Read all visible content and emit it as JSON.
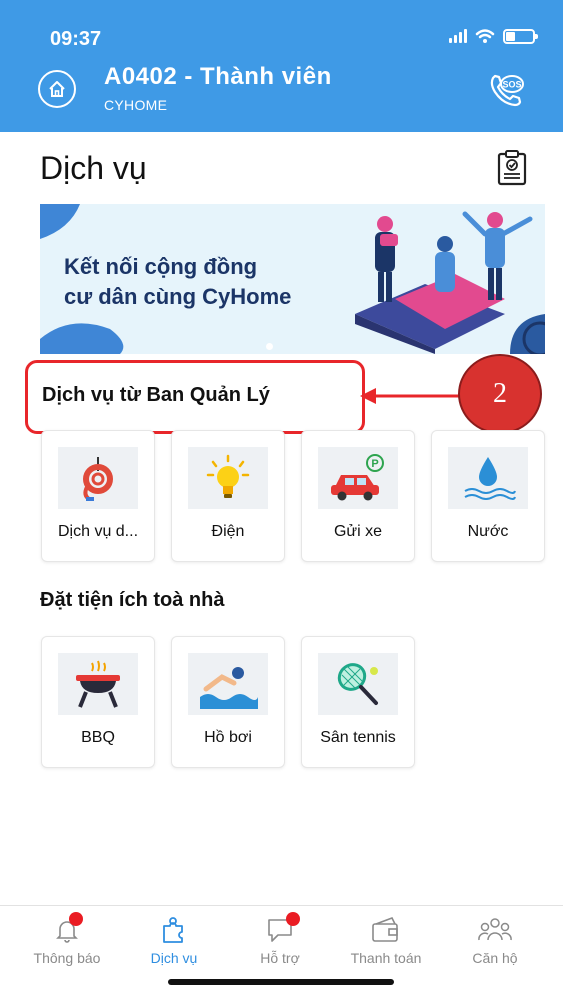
{
  "status_bar": {
    "time": "09:37"
  },
  "header": {
    "title": "A0402 - Thành viên",
    "subtitle": "CYHOME",
    "sos_label": "SOS"
  },
  "page": {
    "title": "Dịch vụ"
  },
  "banner": {
    "line1": "Kết nối cộng đồng",
    "line2": "cư dân cùng CyHome"
  },
  "management_services": {
    "title": "Dịch vụ từ Ban Quản Lý",
    "items": [
      {
        "label": "Dịch vụ d...",
        "icon": "hose-icon"
      },
      {
        "label": "Điện",
        "icon": "lightbulb-icon"
      },
      {
        "label": "Gửi xe",
        "icon": "car-parking-icon"
      },
      {
        "label": "Nước",
        "icon": "water-drop-icon"
      }
    ]
  },
  "annotation": {
    "step": "2",
    "color": "#e8262a"
  },
  "building_amenities": {
    "title": "Đặt tiện ích toà nhà",
    "items": [
      {
        "label": "BBQ",
        "icon": "bbq-grill-icon"
      },
      {
        "label": "Hồ bơi",
        "icon": "swimmer-icon"
      },
      {
        "label": "Sân tennis",
        "icon": "tennis-racket-icon"
      }
    ]
  },
  "tabbar": {
    "items": [
      {
        "label": "Thông báo",
        "icon": "bell-icon",
        "badge": true
      },
      {
        "label": "Dịch vụ",
        "icon": "puzzle-icon",
        "active": true
      },
      {
        "label": "Hỗ trợ",
        "icon": "chat-icon",
        "badge": true
      },
      {
        "label": "Thanh toán",
        "icon": "wallet-icon"
      },
      {
        "label": "Căn hộ",
        "icon": "people-icon"
      }
    ]
  },
  "colors": {
    "header": "#3f9ae6",
    "accent": "#2f8ee0",
    "badge": "#ea1c23"
  }
}
